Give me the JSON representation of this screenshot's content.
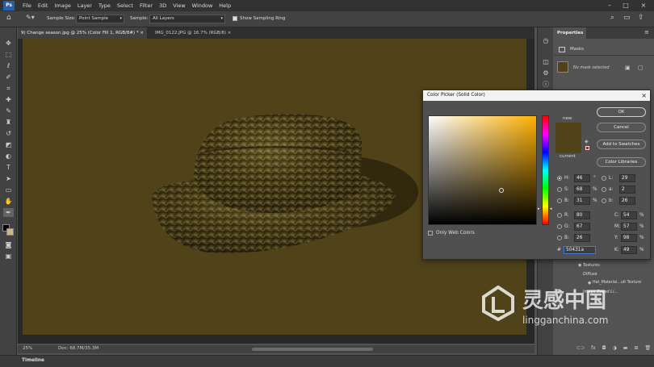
{
  "menubar": {
    "logo": "Ps",
    "items": [
      "File",
      "Edit",
      "Image",
      "Layer",
      "Type",
      "Select",
      "Filter",
      "3D",
      "View",
      "Window",
      "Help"
    ]
  },
  "options": {
    "sample_size_label": "Sample Size:",
    "sample_size_value": "Point Sample",
    "sample_label": "Sample:",
    "sample_value": "All Layers",
    "show_ring_label": "Show Sampling Ring"
  },
  "tabs": [
    {
      "label": "9) Change season.jpg @ 25% (Color Fill 1, RGB/8#) *",
      "close": "×"
    },
    {
      "label": "IMG_0122.JPG @ 16.7% (RGB/8)",
      "close": "×"
    }
  ],
  "status": {
    "zoom": "25%",
    "doc": "Doc: 68.7M/35.3M"
  },
  "timeline_label": "Timeline",
  "properties": {
    "tab_label": "Properties",
    "masks_label": "Masks",
    "no_mask": "No mask selected"
  },
  "layers_fragment": {
    "textures": "Textures",
    "diffuse": "Diffuse",
    "material": "Hat_Material...ult Texture",
    "image_based": "Image Based Li..."
  },
  "dialog": {
    "title": "Color Picker (Solid Color)",
    "new_label": "new",
    "current_label": "current",
    "ok": "OK",
    "cancel": "Cancel",
    "add_swatches": "Add to Swatches",
    "libraries": "Color Libraries",
    "only_web": "Only Web Colors",
    "hash": "#",
    "hex": "50431a",
    "hsb": {
      "h": "46",
      "s": "68",
      "b": "31"
    },
    "rgb": {
      "r": "80",
      "g": "67",
      "b": "26"
    },
    "lab": {
      "l": "29",
      "a": "2",
      "b": "26"
    },
    "cmyk": {
      "c": "54",
      "m": "57",
      "y": "98",
      "k": "49"
    },
    "units": {
      "deg": "°",
      "pct": "%"
    },
    "letters": {
      "H": "H:",
      "S": "S:",
      "B": "B:",
      "R": "R:",
      "G": "G:",
      "Bb": "B:",
      "L": "L:",
      "a": "a:",
      "b": "b:",
      "C": "C:",
      "M": "M:",
      "Y": "Y:",
      "K": "K:"
    }
  },
  "colors": {
    "canvas_fill": "#50431a",
    "hue_pure": "#ffb100",
    "accent": "#2a5ea8"
  },
  "watermark": {
    "cn": "灵感中国",
    "url": "lingganchina.com"
  }
}
